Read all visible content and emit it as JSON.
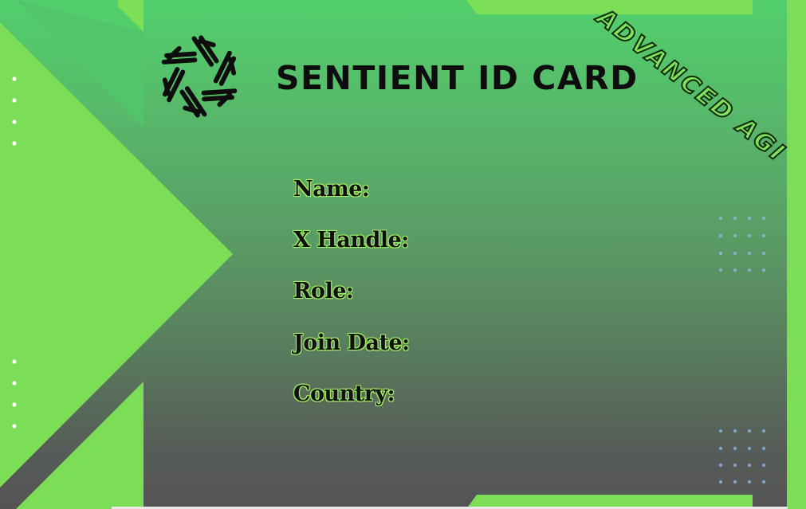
{
  "card": {
    "title": "SENTIENT ID CARD",
    "badge": "ADVANCED AGI",
    "fields": {
      "name": "Name:",
      "x_handle": "X Handle:",
      "role": "Role:",
      "join_date": "Join Date:",
      "country": "Country:"
    }
  },
  "icons": {
    "logo": "sentient-logo-icon"
  },
  "colors": {
    "accent_green": "#7bde56",
    "gradient_top": "#52cf6c",
    "gradient_bottom": "#545454",
    "dots_white": "#ffffff",
    "dots_blue": "#7aa3c9",
    "text_dark": "#0d0d0d"
  }
}
